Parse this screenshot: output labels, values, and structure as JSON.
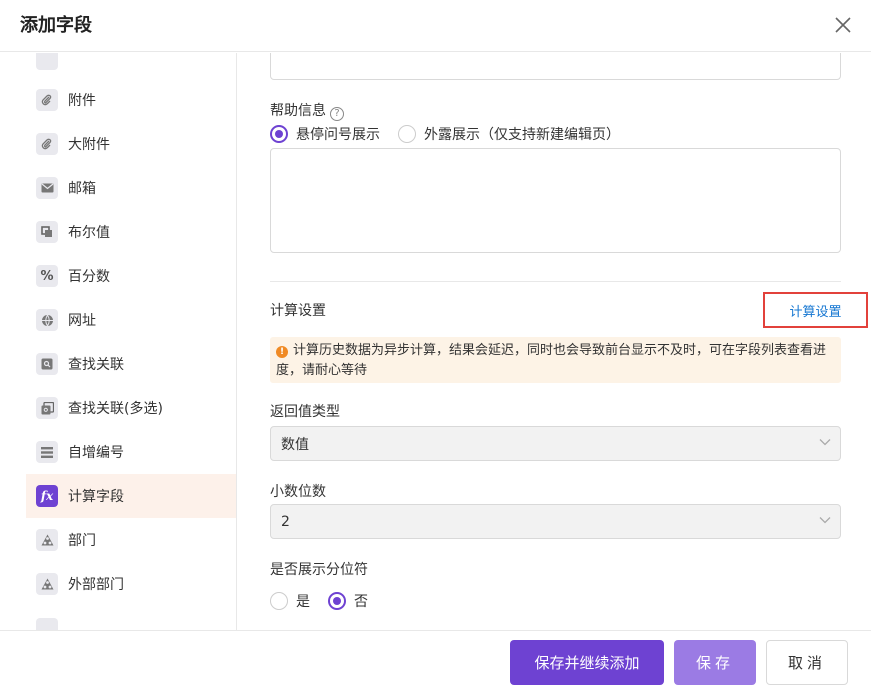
{
  "dialog": {
    "title": "添加字段"
  },
  "sidebar": {
    "items": [
      {
        "label": "附件",
        "icon": "paperclip-icon"
      },
      {
        "label": "大附件",
        "icon": "paperclip-icon"
      },
      {
        "label": "邮箱",
        "icon": "envelope-icon"
      },
      {
        "label": "布尔值",
        "icon": "boolean-icon"
      },
      {
        "label": "百分数",
        "icon": "percent-icon",
        "glyph": "%"
      },
      {
        "label": "网址",
        "icon": "globe-icon"
      },
      {
        "label": "查找关联",
        "icon": "lookup-icon"
      },
      {
        "label": "查找关联(多选)",
        "icon": "lookup-multi-icon"
      },
      {
        "label": "自增编号",
        "icon": "list-icon"
      },
      {
        "label": "计算字段",
        "icon": "function-icon",
        "glyph": "fx"
      },
      {
        "label": "部门",
        "icon": "department-icon"
      },
      {
        "label": "外部部门",
        "icon": "department-icon"
      }
    ],
    "active_index": 9
  },
  "form": {
    "help": {
      "label": "帮助信息",
      "help_glyph": "?",
      "option_hover": "悬停问号展示",
      "option_expose": "外露展示（仅支持新建编辑页）",
      "selected": "hover"
    },
    "calc": {
      "section_title": "计算设置",
      "link_label": "计算设置",
      "notice": "计算历史数据为异步计算，结果会延迟，同时也会导致前台显示不及时，可在字段列表查看进度，请耐心等待",
      "notice_glyph": "!"
    },
    "return_type": {
      "label": "返回值类型",
      "value": "数值"
    },
    "decimals": {
      "label": "小数位数",
      "value": "2"
    },
    "thousands": {
      "label": "是否展示分位符",
      "option_yes": "是",
      "option_no": "否",
      "selected": "no"
    }
  },
  "footer": {
    "save_continue_label": "保存并继续添加",
    "save_label": "保存",
    "cancel_label": "取消"
  },
  "colors": {
    "accent": "#6e42d2",
    "link": "#1677d2",
    "highlight_border": "#e2413b",
    "notice_bg": "#fdf3e6",
    "warn": "#f08a24"
  }
}
